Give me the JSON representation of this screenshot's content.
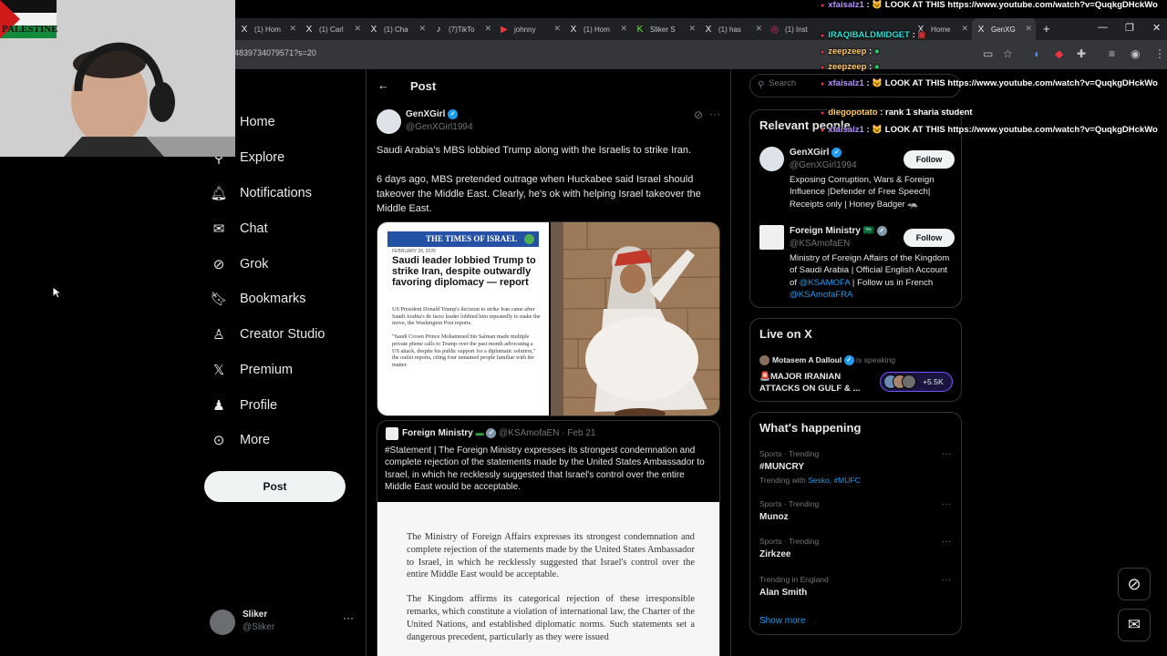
{
  "browser": {
    "tabs": [
      {
        "icon": "X",
        "label": "(1) Hom"
      },
      {
        "icon": "X",
        "label": "(1) Carl"
      },
      {
        "icon": "X",
        "label": "(1) Cha"
      },
      {
        "icon": "♪",
        "label": "(7)TikTo"
      },
      {
        "icon": "▶",
        "label": "johnny"
      },
      {
        "icon": "X",
        "label": "(1) Hom"
      },
      {
        "icon": "K",
        "label": "Sliker S"
      },
      {
        "icon": "X",
        "label": "(1) has"
      },
      {
        "icon": "◎",
        "label": "(1) Inst"
      },
      {
        "icon": "X",
        "label": "(1) Hom"
      },
      {
        "icon": "X",
        "label": "Home"
      },
      {
        "icon": "X",
        "label": "GenXG"
      }
    ],
    "url": "4839734079571?s=20"
  },
  "webcam": {
    "flag_text": "PALESTINE"
  },
  "sidebar": {
    "items": [
      {
        "icon": "home-icon",
        "label": "Home"
      },
      {
        "icon": "search-icon",
        "label": "Explore"
      },
      {
        "icon": "bell-icon",
        "label": "Notifications"
      },
      {
        "icon": "chat-icon",
        "label": "Chat"
      },
      {
        "icon": "grok-icon",
        "label": "Grok"
      },
      {
        "icon": "bookmark-icon",
        "label": "Bookmarks"
      },
      {
        "icon": "creator-icon",
        "label": "Creator Studio"
      },
      {
        "icon": "x-logo-icon",
        "label": "Premium"
      },
      {
        "icon": "person-icon",
        "label": "Profile"
      },
      {
        "icon": "more-icon",
        "label": "More"
      }
    ],
    "post_label": "Post",
    "account": {
      "name": "Sliker",
      "handle": "@Sliker"
    }
  },
  "main": {
    "header": "Post",
    "tweet": {
      "author": "GenXGirl",
      "handle": "@GenXGirl1994",
      "text1": "Saudi Arabia's MBS lobbied Trump along with the Israelis to strike Iran.",
      "text2": "6 days ago, MBS pretended outrage when Huckabee said Israel should takeover the Middle East. Clearly, he's ok with helping Israel takeover the Middle East."
    },
    "article": {
      "masthead": "THE TIMES OF ISRAEL",
      "date": "FEBRUARY 28, 2026",
      "headline": "Saudi leader lobbied Trump to strike Iran, despite outwardly favoring diplomacy — report",
      "body1": "US President Donald Trump's decision to strike Iran came after Saudi Arabia's de facto leader lobbied him repeatedly to make the move, the Washington Post reports.",
      "body2": "\"Saudi Crown Prince Mohammed bin Salman made multiple private phone calls to Trump over the past month advocating a US attack, despite his public support for a diplomatic solution,\" the outlet reports, citing four unnamed people familiar with the matter."
    },
    "quote": {
      "author": "Foreign Ministry",
      "handle": "@KSAmofaEN",
      "date": "· Feb 21",
      "text": "#Statement | The Foreign Ministry expresses its strongest condemnation and complete rejection of the statements made by the United States Ambassador to Israel, in which he recklessly suggested that Israel's control over the entire Middle East would be acceptable.",
      "doc_p1": "The Ministry of Foreign Affairs expresses its strongest condemnation and complete rejection of the statements made by the United States Ambassador to Israel, in which he recklessly suggested that Israel's control over the entire Middle East would be acceptable.",
      "doc_p2": "The Kingdom affirms its categorical rejection of these irresponsible remarks, which constitute a violation of international law, the Charter of the United Nations, and established diplomatic norms. Such statements set a dangerous precedent, particularly as they were issued"
    }
  },
  "right": {
    "search_placeholder": "Search",
    "relevant": {
      "title": "Relevant people",
      "people": [
        {
          "name": "GenXGirl",
          "handle": "@GenXGirl1994",
          "bio": "Exposing Corruption, Wars & Foreign Influence |Defender of Free Speech| Receipts only | Honey Badger 🦡",
          "follow": "Follow"
        },
        {
          "name": "Foreign Ministry 🇸🇦",
          "handle": "@KSAmofaEN",
          "bio_pre": "Ministry of Foreign Affairs of the Kingdom of Saudi Arabia | Official English Account of ",
          "bio_link1": "@KSAMOFA",
          "bio_mid": " | Follow us in French ",
          "bio_link2": "@KSAmofaFRA",
          "follow": "Follow"
        }
      ]
    },
    "live": {
      "title": "Live on X",
      "host": "Motasem A Dalloul",
      "status": "is speaking",
      "headline": "🚨MAJOR IRANIAN ATTACKS ON GULF & ...",
      "count": "+5.5K"
    },
    "happening": {
      "title": "What's happening",
      "trends": [
        {
          "meta": "Sports · Trending",
          "name": "#MUNCRY",
          "with_label": "Trending with",
          "with": "Sesko, #MUFC"
        },
        {
          "meta": "Sports · Trending",
          "name": "Munoz"
        },
        {
          "meta": "Sports · Trending",
          "name": "Zirkzee"
        },
        {
          "meta": "Trending in England",
          "name": "Alan Smith"
        }
      ],
      "show_more": "Show more"
    }
  },
  "chat": [
    {
      "user": "xfaisalz1",
      "msg": "LOOK AT THIS https://www.youtube.com/watch?v=QuqkgDHckWo"
    },
    {
      "user": "IRAQIBALDMIDGET",
      "msg": ":"
    },
    {
      "user": "zeepzeep",
      "msg": ":"
    },
    {
      "user": "zeepzeep",
      "msg": ":"
    },
    {
      "user": "xfaisalz1",
      "msg": "LOOK AT THIS https://www.youtube.com/watch?v=QuqkgDHckWo"
    },
    {
      "user": "diegopotato",
      "msg": ": rank 1 sharia student"
    },
    {
      "user": "xfaisalz1",
      "msg": "LOOK AT THIS https://www.youtube.com/watch?v=QuqkgDHckWo"
    }
  ],
  "colors": {
    "accent": "#1d9bf0",
    "bg": "#000000",
    "border": "#2f3336",
    "muted": "#71767b"
  }
}
